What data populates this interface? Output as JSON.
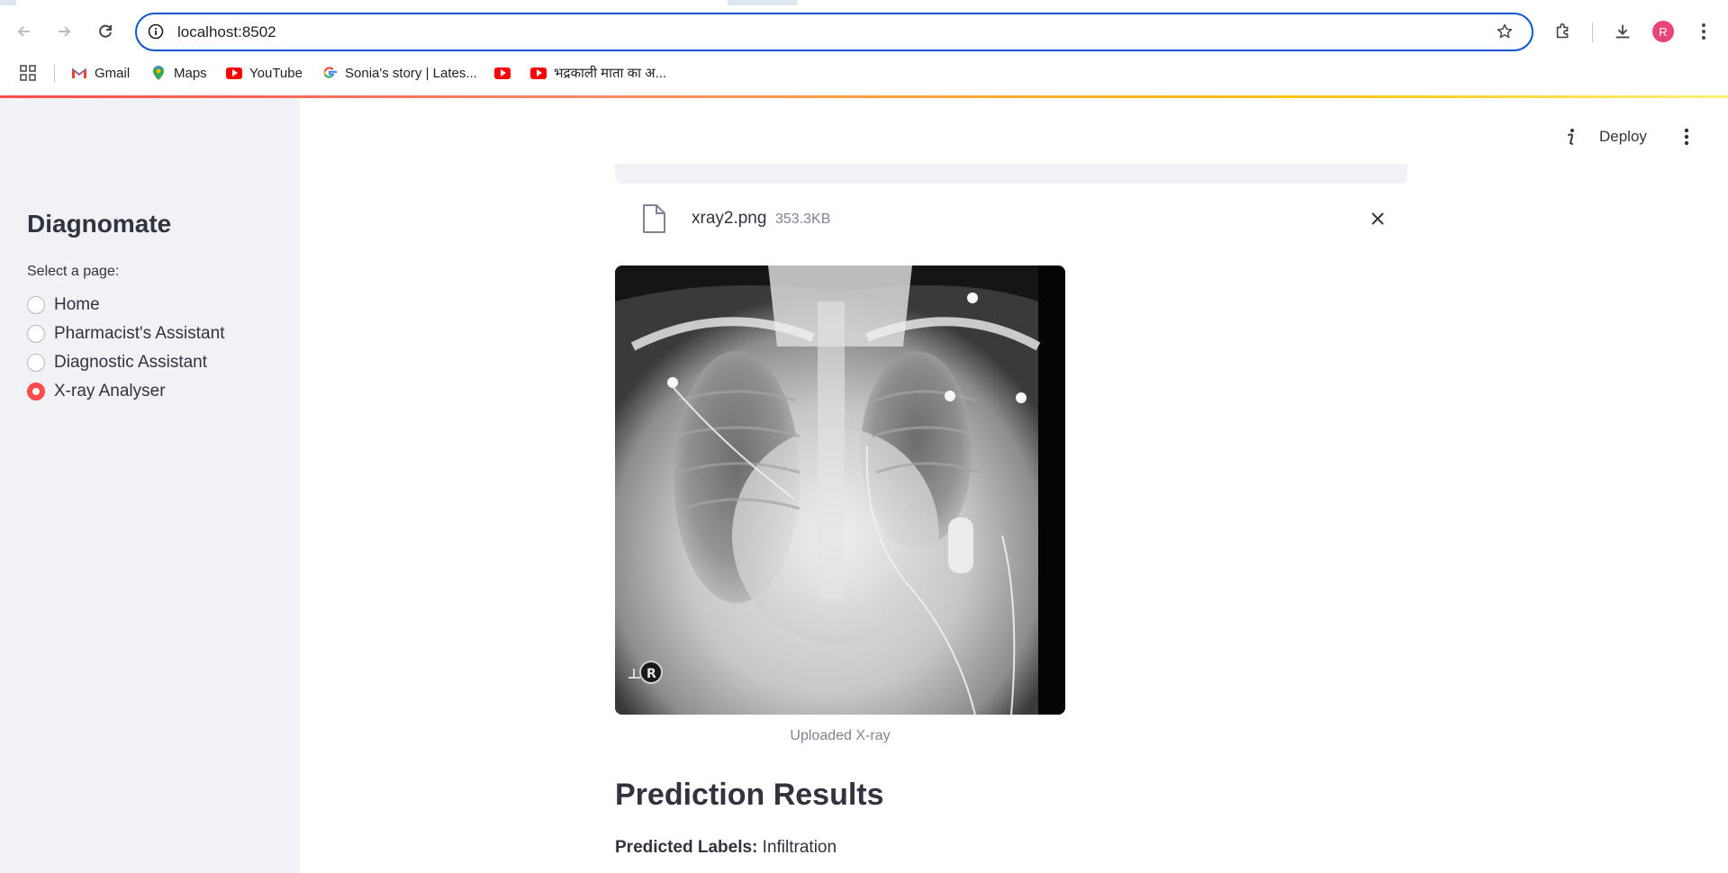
{
  "browser": {
    "url": "localhost:8502",
    "avatar_letter": "R",
    "bookmarks": [
      {
        "label": "Gmail",
        "icon": "gmail-icon"
      },
      {
        "label": "Maps",
        "icon": "maps-icon"
      },
      {
        "label": "YouTube",
        "icon": "youtube-icon"
      },
      {
        "label": "Sonia's story | Lates...",
        "icon": "google-icon"
      },
      {
        "label": "",
        "icon": "youtube-icon"
      },
      {
        "label": "भद्रकाली माता का अ...",
        "icon": "youtube-icon"
      }
    ]
  },
  "sidebar": {
    "title": "Diagnomate",
    "select_label": "Select a page:",
    "options": [
      {
        "label": "Home",
        "selected": false
      },
      {
        "label": "Pharmacist's Assistant",
        "selected": false
      },
      {
        "label": "Diagnostic Assistant",
        "selected": false
      },
      {
        "label": "X-ray Analyser",
        "selected": true
      }
    ]
  },
  "header": {
    "deploy_label": "Deploy"
  },
  "uploader": {
    "file_name": "xray2.png",
    "file_size": "353.3KB"
  },
  "image": {
    "caption": "Uploaded X-ray",
    "marker": "R"
  },
  "results": {
    "heading": "Prediction Results",
    "predicted_label_key": "Predicted Labels:",
    "predicted_label_value": "Infiltration"
  },
  "colors": {
    "accent": "#ff4b4b",
    "sidebar_bg": "#f0f2f6",
    "text": "#31333f",
    "omnibox_border": "#0b57d0"
  }
}
